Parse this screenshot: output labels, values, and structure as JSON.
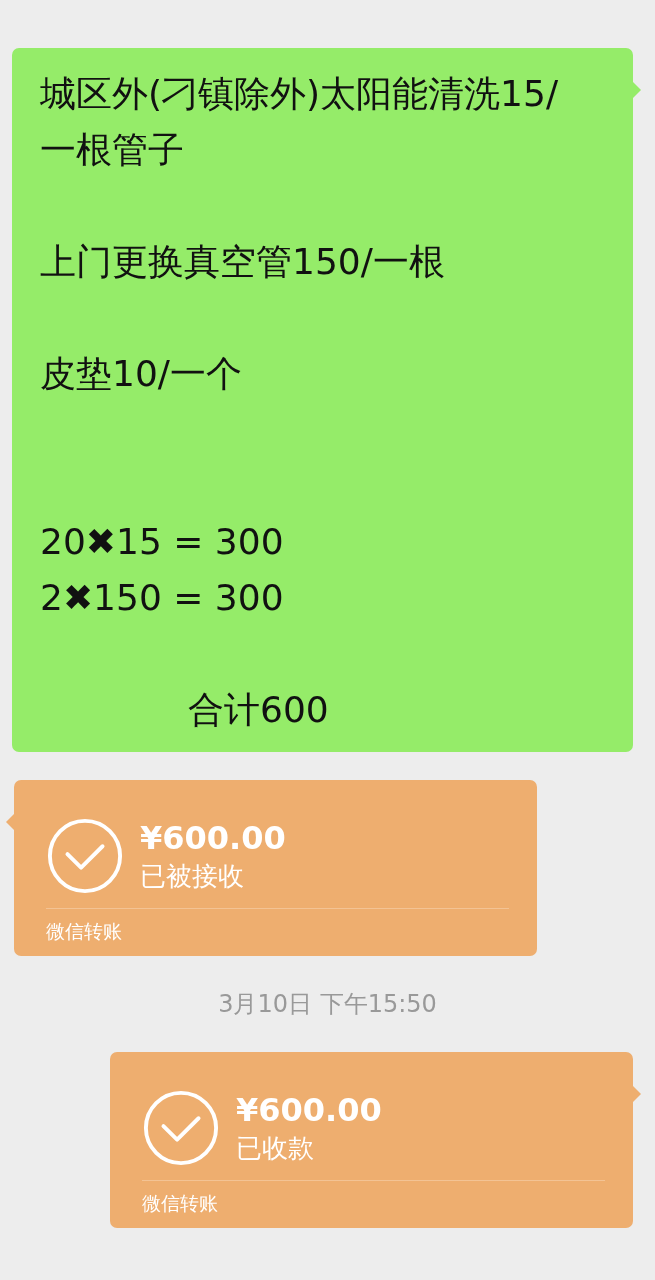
{
  "messages": [
    {
      "kind": "text",
      "outgoing": true,
      "lines": [
        "城区外(刁镇除外)太阳能清洗15/一根管子",
        "上门更换真空管150/一根",
        "皮垫10/一个",
        "20✖15 = 300",
        "2✖150 = 300",
        "合计600"
      ]
    },
    {
      "kind": "transfer",
      "outgoing": false,
      "amount": "¥600.00",
      "status": "已被接收",
      "footer": "微信转账"
    },
    {
      "kind": "time",
      "text": "3月10日 下午15:50"
    },
    {
      "kind": "transfer",
      "outgoing": true,
      "amount": "¥600.00",
      "status": "已收款",
      "footer": "微信转账"
    }
  ]
}
